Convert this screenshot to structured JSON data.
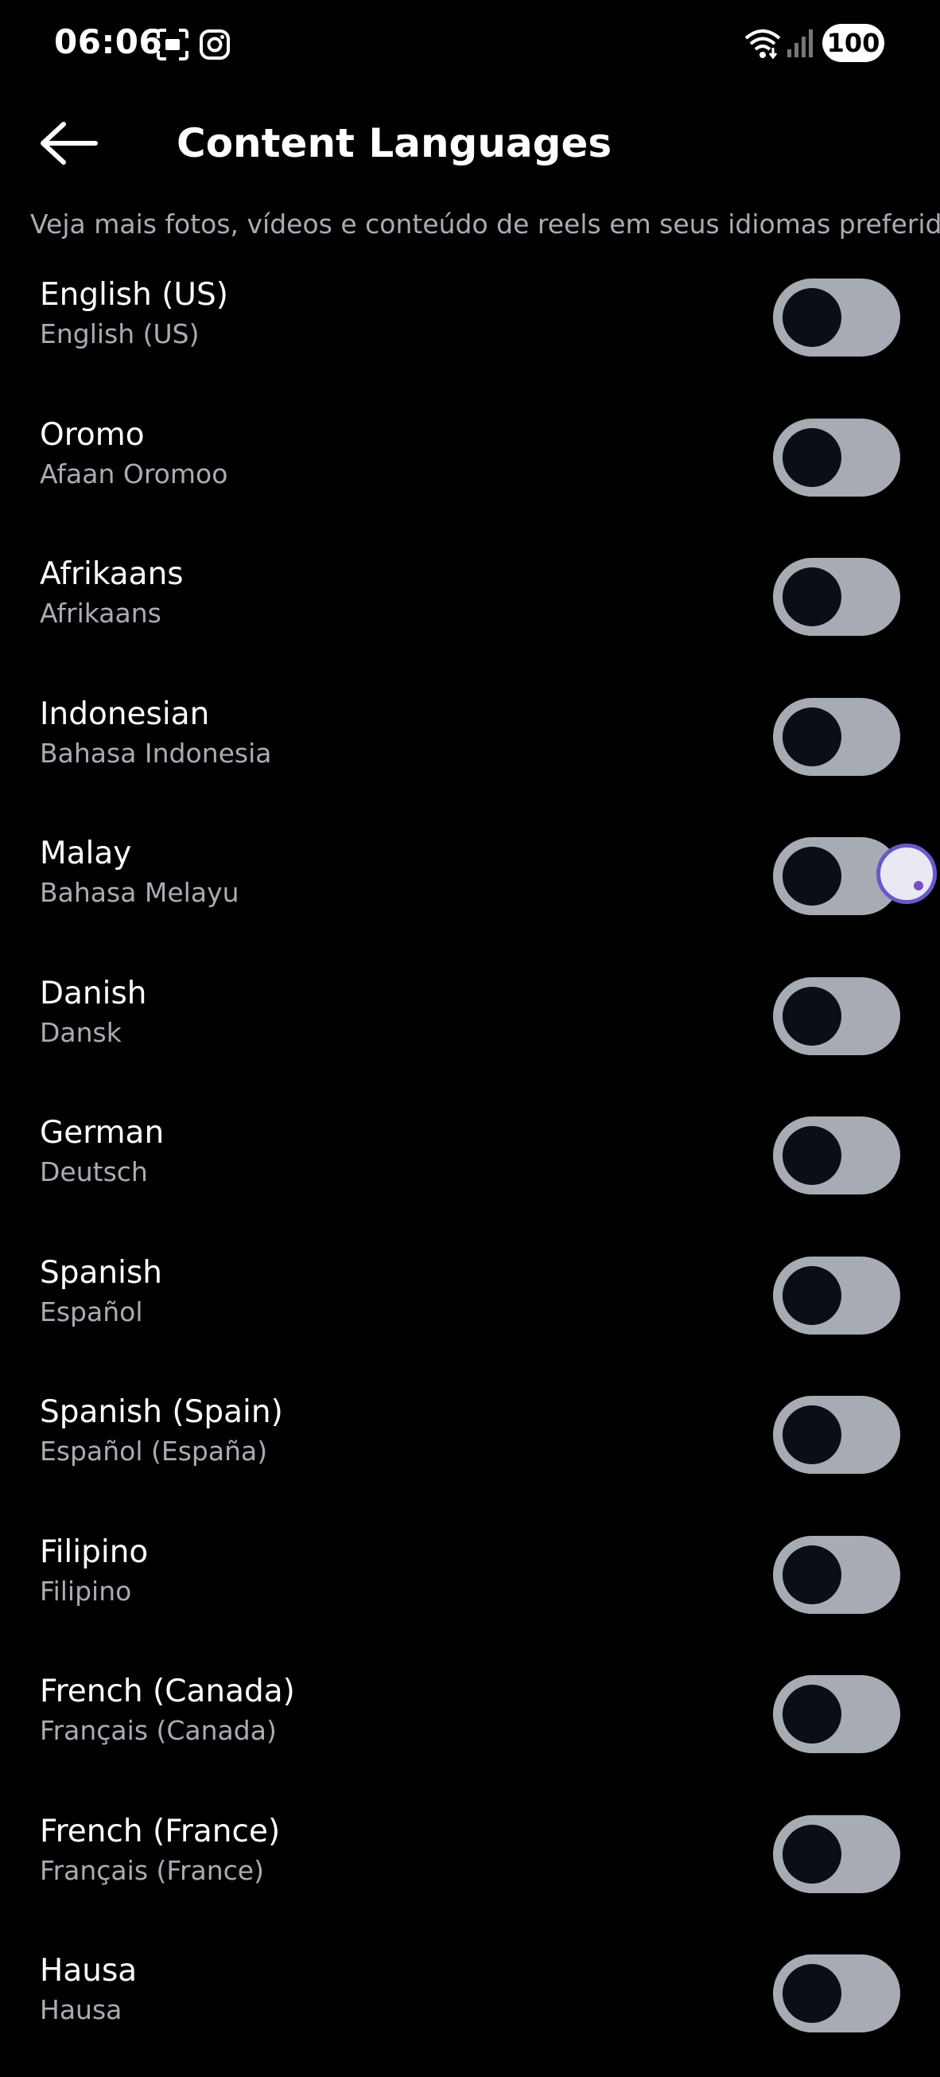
{
  "status_bar": {
    "time": "06:06",
    "battery": "100",
    "icons": [
      "screenshot-icon",
      "instagram-icon",
      "wifi-icon",
      "signal-icon",
      "battery-icon"
    ]
  },
  "header": {
    "back_icon": "arrow-left-icon",
    "title": "Content Languages"
  },
  "subtitle": "Veja mais fotos, vídeos e conteúdo de reels em seus idiomas preferidos.",
  "languages": [
    {
      "name": "English (US)",
      "native": "English (US)",
      "enabled": false
    },
    {
      "name": "Oromo",
      "native": "Afaan Oromoo",
      "enabled": false
    },
    {
      "name": "Afrikaans",
      "native": "Afrikaans",
      "enabled": false
    },
    {
      "name": "Indonesian",
      "native": "Bahasa Indonesia",
      "enabled": false
    },
    {
      "name": "Malay",
      "native": "Bahasa Melayu",
      "enabled": false
    },
    {
      "name": "Danish",
      "native": "Dansk",
      "enabled": false
    },
    {
      "name": "German",
      "native": "Deutsch",
      "enabled": false
    },
    {
      "name": "Spanish",
      "native": "Español",
      "enabled": false
    },
    {
      "name": "Spanish (Spain)",
      "native": "Español (España)",
      "enabled": false
    },
    {
      "name": "Filipino",
      "native": "Filipino",
      "enabled": false
    },
    {
      "name": "French (Canada)",
      "native": "Français (Canada)",
      "enabled": false
    },
    {
      "name": "French (France)",
      "native": "Français (France)",
      "enabled": false
    },
    {
      "name": "Hausa",
      "native": "Hausa",
      "enabled": false
    }
  ],
  "colors": {
    "background": "#000000",
    "toggle_track_off": "#a7abb3",
    "toggle_knob": "#0b0e14",
    "secondary_text": "#a8acb4"
  }
}
